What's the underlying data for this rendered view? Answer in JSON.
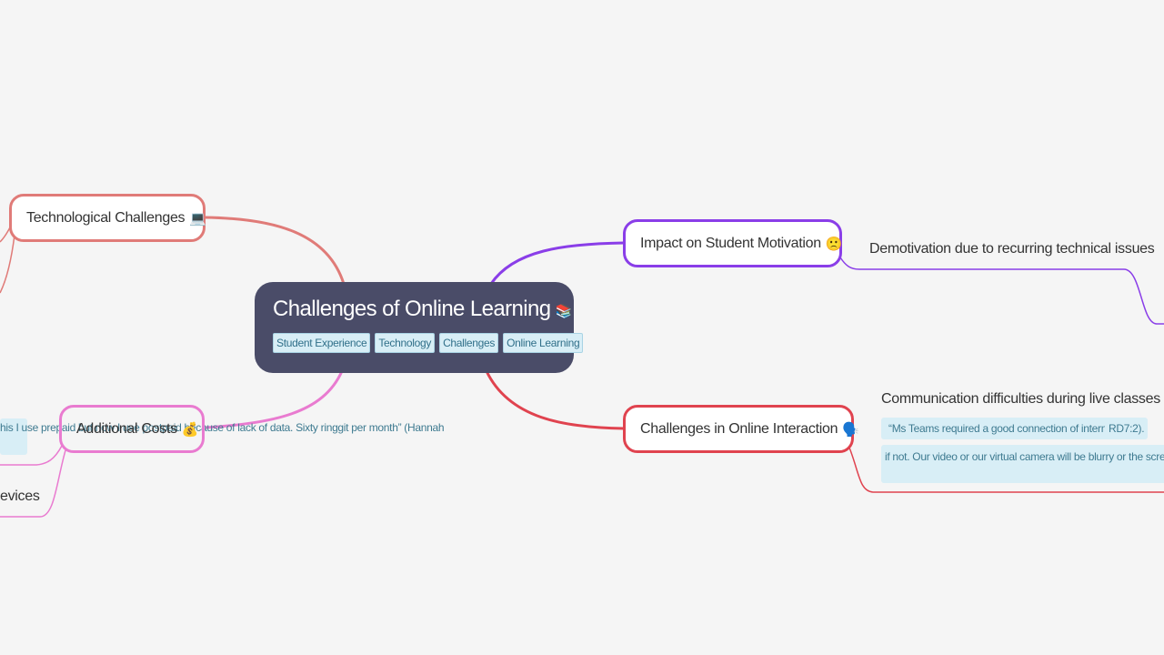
{
  "central": {
    "title": "Challenges of Online Learning",
    "emoji": "📚",
    "tags": [
      "Student Experience",
      "Technology",
      "Challenges",
      "Online Learning"
    ]
  },
  "branches": {
    "technological": {
      "label": "Technological Challenges",
      "emoji": "💻",
      "color": "#e07b78"
    },
    "costs": {
      "label": "Additional Costs",
      "emoji": "💰",
      "color": "#e97bd0",
      "note": "his I use prepaid but now I use postpaid because of lack of data. Sixty ringgit per month”   (Hannah",
      "leaf": "evices"
    },
    "motivation": {
      "label": "Impact on Student Motivation",
      "emoji": "🙁",
      "color": "#8a3ee8",
      "leaf": "Demotivation due to recurring technical issues"
    },
    "interaction": {
      "label": "Challenges in Online Interaction",
      "emoji": "🗣️",
      "color": "#e0434f",
      "leaf": "Communication difficulties during live classes",
      "notes": [
        "“Ms Teams required a good connection of internet",
        "RD7:2).",
        "if not. Our video or our virtual camera will be blurry or the screen w"
      ]
    }
  }
}
